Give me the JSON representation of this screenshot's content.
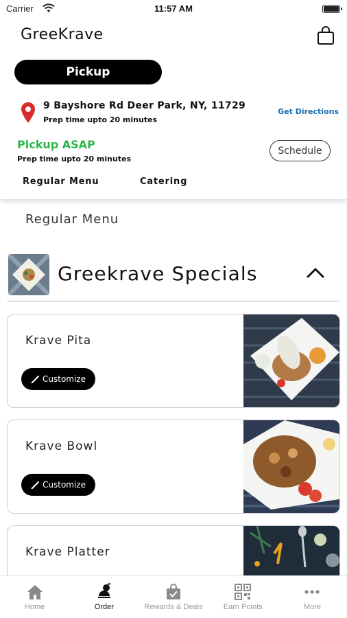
{
  "status_bar": {
    "carrier": "Carrier",
    "time": "11:57 AM"
  },
  "header": {
    "app_title": "GreeKrave",
    "mode": "Pickup",
    "address": "9 Bayshore Rd Deer Park, NY, 11729",
    "prep_time": "Prep time upto 20 minutes",
    "directions_label": "Get Directions",
    "pickup_status": "Pickup ASAP",
    "pickup_prep": "Prep time upto 20 minutes",
    "schedule_label": "Schedule",
    "tabs": [
      {
        "label": "Regular Menu"
      },
      {
        "label": "Catering"
      }
    ]
  },
  "menu": {
    "section_label": "Regular Menu",
    "category": "Greekrave Specials",
    "items": [
      {
        "name": "Krave Pita",
        "customize": "Customize"
      },
      {
        "name": "Krave Bowl",
        "customize": "Customize"
      },
      {
        "name": "Krave Platter"
      }
    ]
  },
  "tab_bar": [
    {
      "label": "Home",
      "icon": "home-icon"
    },
    {
      "label": "Order",
      "icon": "order-icon",
      "active": true
    },
    {
      "label": "Rewards & Deals",
      "icon": "rewards-icon"
    },
    {
      "label": "Earn Points",
      "icon": "qr-code-icon"
    },
    {
      "label": "More",
      "icon": "more-icon"
    }
  ],
  "colors": {
    "accent_green": "#2cb84a",
    "link_blue": "#1b6fb5",
    "pin_red": "#d92b2b"
  }
}
